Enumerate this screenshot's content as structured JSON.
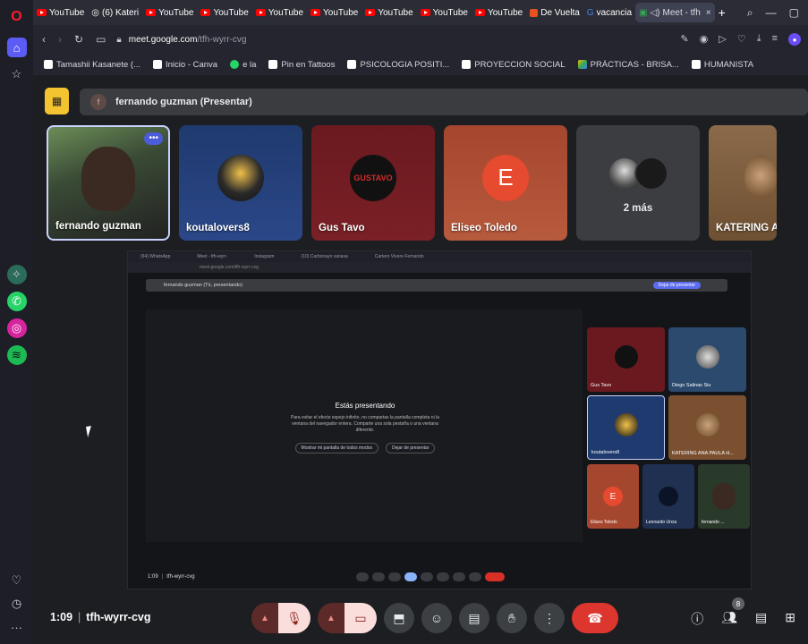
{
  "browser": {
    "tabs": [
      {
        "label": "YouTube",
        "type": "youtube"
      },
      {
        "label": "(6) Kateri",
        "type": "instagram"
      },
      {
        "label": "YouTube",
        "type": "youtube"
      },
      {
        "label": "YouTube",
        "type": "youtube"
      },
      {
        "label": "YouTube",
        "type": "youtube"
      },
      {
        "label": "YouTube",
        "type": "youtube"
      },
      {
        "label": "YouTube",
        "type": "youtube"
      },
      {
        "label": "YouTube",
        "type": "youtube"
      },
      {
        "label": "YouTube",
        "type": "youtube"
      },
      {
        "label": "De Vuelta",
        "type": "other"
      },
      {
        "label": "vacancia",
        "type": "google"
      },
      {
        "label": "Meet - tfh",
        "type": "meet"
      }
    ],
    "url_host": "meet.google.com",
    "url_path": "/tfh-wyrr-cvg",
    "bookmarks": [
      {
        "label": "Tamashii Kasanete (...",
        "color": "#ffffff"
      },
      {
        "label": "Inicio - Canva",
        "color": "#ffffff"
      },
      {
        "label": "e la",
        "color": "#25d366"
      },
      {
        "label": "Pin en Tattoos",
        "color": "#ffffff"
      },
      {
        "label": "PSICOLOGIA POSITI...",
        "color": "#ffffff"
      },
      {
        "label": "PROYECCION SOCIAL",
        "color": "#ffffff"
      },
      {
        "label": "PRÁCTICAS - BRISA...",
        "color": "#34a853"
      },
      {
        "label": "HUMANISTA",
        "color": "#ffffff"
      }
    ]
  },
  "meet": {
    "presenter_initial": "f",
    "presenter_label": "fernando guzman (Presentar)",
    "participants": [
      {
        "name": "fernando guzman",
        "kind": "camera"
      },
      {
        "name": "koutalovers8",
        "kind": "anime-avatar"
      },
      {
        "name": "Gus Tavo",
        "kind": "gus-avatar"
      },
      {
        "name": "Eliseo Toledo",
        "kind": "letter",
        "letter": "E"
      },
      {
        "name": "2 más",
        "kind": "more"
      },
      {
        "name": "KATERING ANA PA...",
        "kind": "cat-avatar"
      }
    ],
    "more_menu": "•••",
    "gus_logo_text": "GUSTAVO",
    "meeting_time": "1:09",
    "meeting_code": "tfh-wyrr-cvg",
    "participant_count": "8",
    "accent": "#dc362e"
  },
  "shared_screen": {
    "inner_tabs": [
      "(94) WhatsApp",
      "Meet - tfh-wyrr-",
      "Instagram",
      "(10) Carbonayo vanasa",
      "Cartero Vivere Fernando"
    ],
    "inner_url": "meet.google.com/tfh-wyrr-cvg",
    "inner_presenter": "fernando guzman (Tú, presentando)",
    "stop_label": "Dejar de presentar",
    "title": "Estás presentando",
    "subtitle": "Para evitar el efecto espejo infinito, no compartas la pantalla completa ni la ventana del navegador entera. Comparte una sola pestaña o una ventana diferente.",
    "btn_show": "Mostrar mi pantalla de todos modos",
    "btn_stop": "Dejar de presentar",
    "mini_tiles": [
      {
        "name": "Gus Tavo",
        "color": "#6a1a1f"
      },
      {
        "name": "Diego Salinas Siu",
        "color": "#2b4a6e"
      },
      {
        "name": "koutalovers8",
        "color": "#1f3a6e"
      },
      {
        "name": "KATERING ANA PAULA H...",
        "color": "#7a5030"
      }
    ],
    "mini_row": [
      {
        "name": "Eliseo Toledo",
        "color": "#a5462f"
      },
      {
        "name": "Leonardo Urcia",
        "color": "#1f3050"
      },
      {
        "name": "fernando ...",
        "color": "#2a3a2a"
      }
    ],
    "inner_time": "1:09",
    "inner_code": "tfh-wyrr-cvg"
  }
}
